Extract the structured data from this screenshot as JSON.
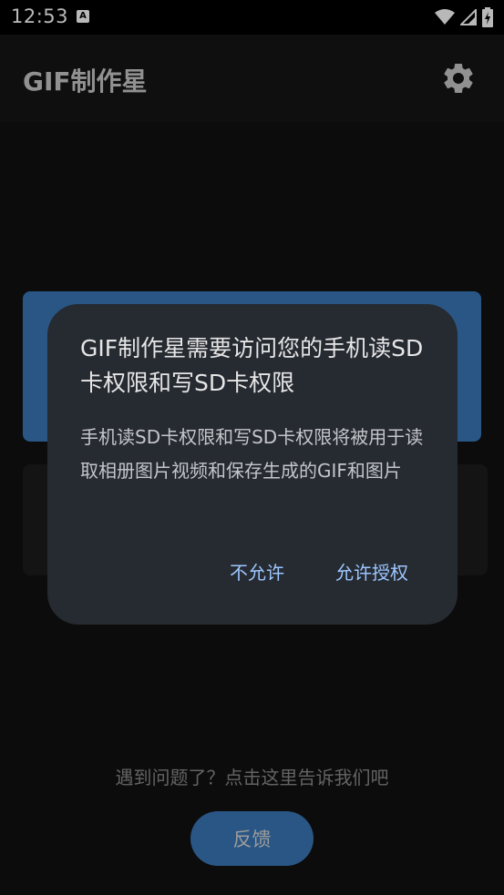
{
  "status_bar": {
    "time": "12:53",
    "notification_letter": "A"
  },
  "app_bar": {
    "title": "GIF制作星",
    "settings_icon": "gear-icon"
  },
  "background": {
    "help_text": "遇到问题了？点击这里告诉我们吧",
    "feedback_label": "反馈"
  },
  "dialog": {
    "title": "GIF制作星需要访问您的手机读SD卡权限和写SD卡权限",
    "message": "手机读SD卡权限和写SD卡权限将被用于读取相册图片视频和保存生成的GIF和图片",
    "deny_label": "不允许",
    "allow_label": "允许授权"
  },
  "colors": {
    "accent": "#3a78b8",
    "dialog_bg": "#262a31",
    "dialog_button": "#9cc7ff"
  }
}
